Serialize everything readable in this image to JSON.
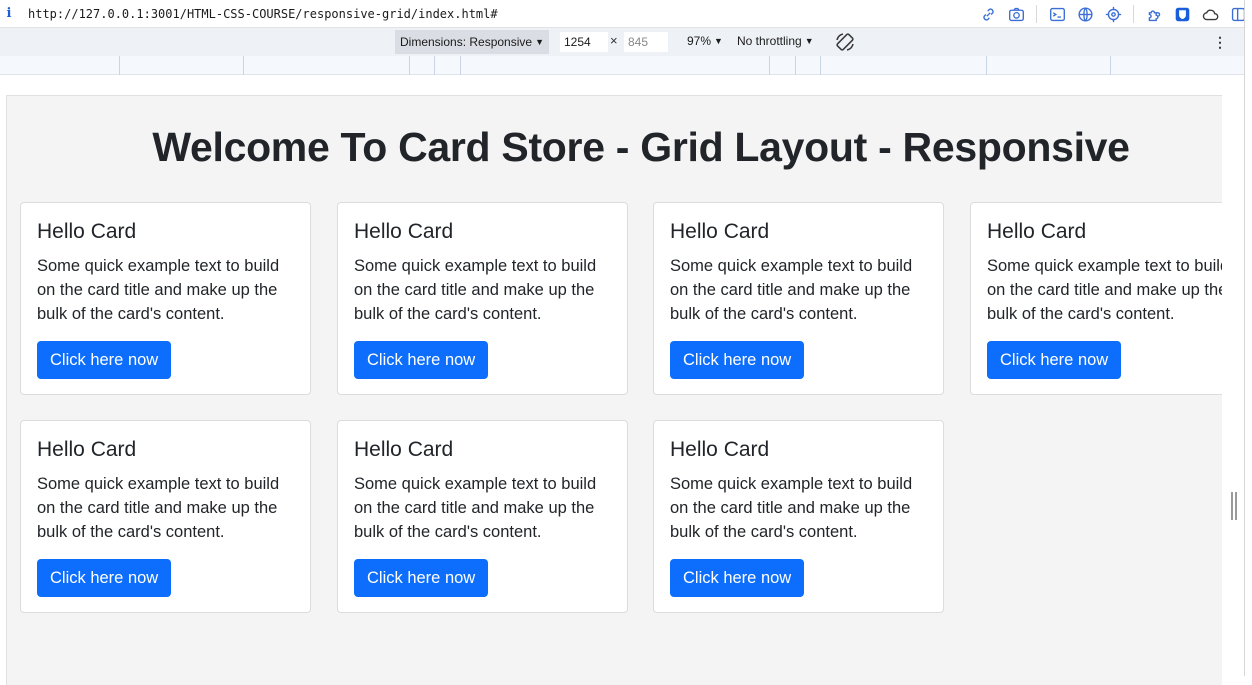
{
  "browser": {
    "url": "http://127.0.0.1:3001/HTML-CSS-COURSE/responsive-grid/index.html#",
    "info_icon": "i"
  },
  "responsive_toolbar": {
    "dimensions_label": "Dimensions: Responsive",
    "width_value": "1254",
    "times_sign": "×",
    "height_placeholder": "845",
    "zoom": "97%",
    "throttling": "No throttling"
  },
  "page": {
    "title": "Welcome To Card Store - Grid Layout - Responsive",
    "cards": [
      {
        "title": "Hello Card",
        "lines": [
          "Some quick example text to build",
          "on the card title and make up the",
          "bulk of the card's content."
        ],
        "button": "Click here now"
      },
      {
        "title": "Hello Card",
        "lines": [
          "Some quick example text to build",
          "on the card title and make up the",
          "bulk of the card's content."
        ],
        "button": "Click here now"
      },
      {
        "title": "Hello Card",
        "lines": [
          "Some quick example text to build",
          "on the card title and make up the",
          "bulk of the card's content."
        ],
        "button": "Click here now"
      },
      {
        "title": "Hello Card",
        "lines": [
          "Some quick example text to build",
          "on the card title and make up the",
          "bulk of the card's content."
        ],
        "button": "Click here now"
      },
      {
        "title": "Hello Card",
        "lines": [
          "Some quick example text to build",
          "on the card title and make up the",
          "bulk of the card's content."
        ],
        "button": "Click here now"
      },
      {
        "title": "Hello Card",
        "lines": [
          "Some quick example text to build",
          "on the card title and make up the",
          "bulk of the card's content."
        ],
        "button": "Click here now"
      },
      {
        "title": "Hello Card",
        "lines": [
          "Some quick example text to build",
          "on the card title and make up the",
          "bulk of the card's content."
        ],
        "button": "Click here now"
      }
    ]
  },
  "colors": {
    "button_bg": "#0d6efd",
    "page_bg": "#f4f4f4",
    "link_icon_blue": "#3b6fd6"
  },
  "icons": [
    "info-icon",
    "link-icon",
    "camera-icon",
    "terminal-icon",
    "globe-icon",
    "crosshair-icon",
    "extension-icon",
    "bitwarden-icon",
    "cloud-icon",
    "sidebar-icon",
    "rotate-icon",
    "more-menu-icon"
  ]
}
